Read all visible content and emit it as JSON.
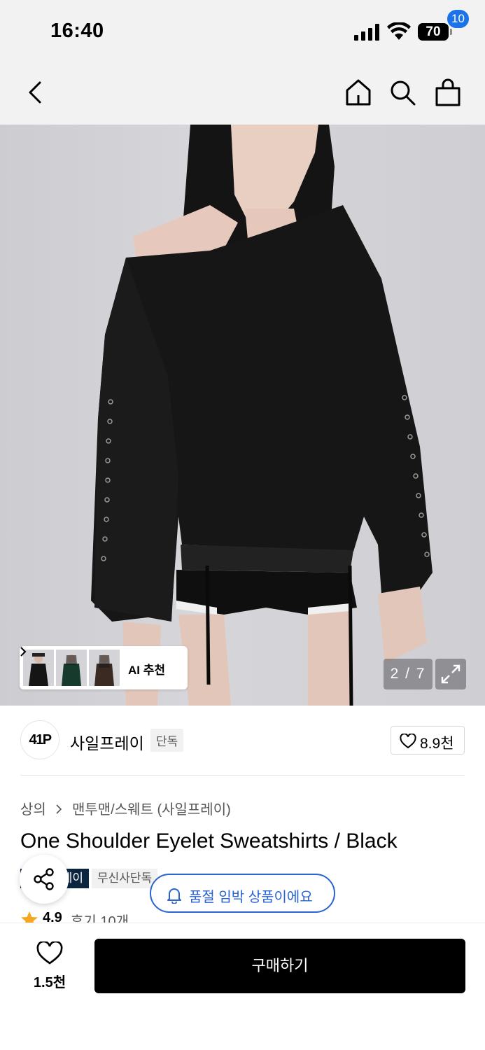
{
  "status_bar": {
    "time": "16:40",
    "battery": "70"
  },
  "header": {
    "cart_count": "10"
  },
  "gallery": {
    "ai_recommend_label": "AI 추천",
    "page_counter": "2 / 7"
  },
  "brand": {
    "logo_text": "41P",
    "name": "사일프레이",
    "tag": "단독",
    "likes": "8.9천"
  },
  "breadcrumb": [
    "상의",
    "맨투맨/스웨트 (사일프레이)"
  ],
  "product": {
    "title": "One Shoulder Eyelet Sweatshirts / Black",
    "tag_dark": "레이",
    "tag_light": "무신사단독",
    "soldout_notice": "품절 임박 상품이에요",
    "rating": "4.9",
    "reviews": "후기 10개"
  },
  "bottom_bar": {
    "wish_count": "1.5천",
    "buy_label": "구매하기"
  },
  "colors": {
    "accent_blue": "#2a63d4",
    "badge_blue": "#1a73e8",
    "tag_navy": "#0b2540",
    "star": "#f5a623"
  }
}
